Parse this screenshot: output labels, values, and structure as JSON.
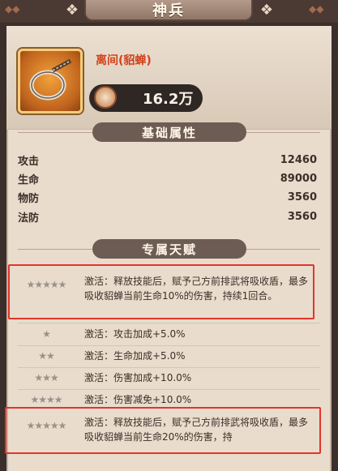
{
  "header": {
    "title": "神兵"
  },
  "item": {
    "name": "离间(貂蝉)",
    "power": "16.2万"
  },
  "sections": {
    "base_attributes": "基础属性",
    "exclusive_talent": "专属天赋"
  },
  "attributes": [
    {
      "label": "攻击",
      "value": "12460"
    },
    {
      "label": "生命",
      "value": "89000"
    },
    {
      "label": "物防",
      "value": "3560"
    },
    {
      "label": "法防",
      "value": "3560"
    }
  ],
  "talents": [
    {
      "stars": "★★★★★",
      "text": "激活：释放技能后，赋予己方前排武将吸收盾，最多吸收貂蝉当前生命10%的伤害，持续1回合。"
    },
    {
      "stars": "★",
      "text": "激活：攻击加成+5.0%"
    },
    {
      "stars": "★★",
      "text": "激活：生命加成+5.0%"
    },
    {
      "stars": "★★★",
      "text": "激活：伤害加成+10.0%"
    },
    {
      "stars": "★★★★",
      "text": "激活：伤害减免+10.0%"
    },
    {
      "stars": "★★★★★",
      "text": "激活：释放技能后，赋予己方前排武将吸收盾，最多吸收貂蝉当前生命20%的伤害，持"
    }
  ],
  "colors": {
    "highlight_box": "#e2352c",
    "item_name": "#d2421a"
  },
  "icons": {
    "item": "whip-icon",
    "power": "power-gem-icon"
  }
}
